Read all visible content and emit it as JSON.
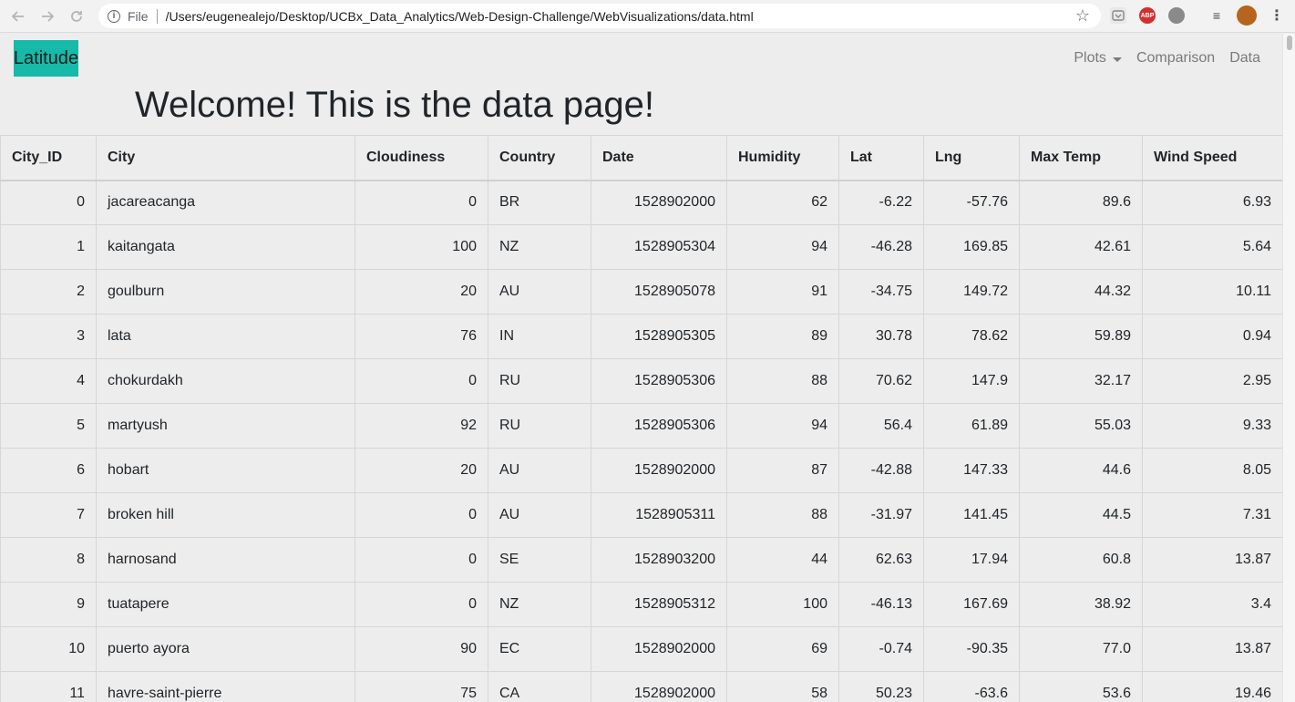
{
  "browser": {
    "file_label": "File",
    "url": "/Users/eugenealejo/Desktop/UCBx_Data_Analytics/Web-Design-Challenge/WebVisualizations/data.html",
    "ext_abp": "ABP",
    "icons": [
      "back-arrow-icon",
      "forward-arrow-icon",
      "reload-icon",
      "info-icon",
      "star-icon",
      "menu-dots-icon"
    ]
  },
  "navbar": {
    "brand": "Latitude",
    "brand_color": "#17b9a8",
    "links": [
      {
        "label": "Plots",
        "dropdown": true
      },
      {
        "label": "Comparison"
      },
      {
        "label": "Data"
      }
    ]
  },
  "page": {
    "heading": "Welcome! This is the data page!"
  },
  "table": {
    "headers": [
      "City_ID",
      "City",
      "Cloudiness",
      "Country",
      "Date",
      "Humidity",
      "Lat",
      "Lng",
      "Max Temp",
      "Wind Speed"
    ],
    "rows": [
      [
        "0",
        "jacareacanga",
        "0",
        "BR",
        "1528902000",
        "62",
        "-6.22",
        "-57.76",
        "89.6",
        "6.93"
      ],
      [
        "1",
        "kaitangata",
        "100",
        "NZ",
        "1528905304",
        "94",
        "-46.28",
        "169.85",
        "42.61",
        "5.64"
      ],
      [
        "2",
        "goulburn",
        "20",
        "AU",
        "1528905078",
        "91",
        "-34.75",
        "149.72",
        "44.32",
        "10.11"
      ],
      [
        "3",
        "lata",
        "76",
        "IN",
        "1528905305",
        "89",
        "30.78",
        "78.62",
        "59.89",
        "0.94"
      ],
      [
        "4",
        "chokurdakh",
        "0",
        "RU",
        "1528905306",
        "88",
        "70.62",
        "147.9",
        "32.17",
        "2.95"
      ],
      [
        "5",
        "martyush",
        "92",
        "RU",
        "1528905306",
        "94",
        "56.4",
        "61.89",
        "55.03",
        "9.33"
      ],
      [
        "6",
        "hobart",
        "20",
        "AU",
        "1528902000",
        "87",
        "-42.88",
        "147.33",
        "44.6",
        "8.05"
      ],
      [
        "7",
        "broken hill",
        "0",
        "AU",
        "1528905311",
        "88",
        "-31.97",
        "141.45",
        "44.5",
        "7.31"
      ],
      [
        "8",
        "harnosand",
        "0",
        "SE",
        "1528903200",
        "44",
        "62.63",
        "17.94",
        "60.8",
        "13.87"
      ],
      [
        "9",
        "tuatapere",
        "0",
        "NZ",
        "1528905312",
        "100",
        "-46.13",
        "167.69",
        "38.92",
        "3.4"
      ],
      [
        "10",
        "puerto ayora",
        "90",
        "EC",
        "1528902000",
        "69",
        "-0.74",
        "-90.35",
        "77.0",
        "13.87"
      ],
      [
        "11",
        "havre-saint-pierre",
        "75",
        "CA",
        "1528902000",
        "58",
        "50.23",
        "-63.6",
        "53.6",
        "19.46"
      ]
    ]
  }
}
